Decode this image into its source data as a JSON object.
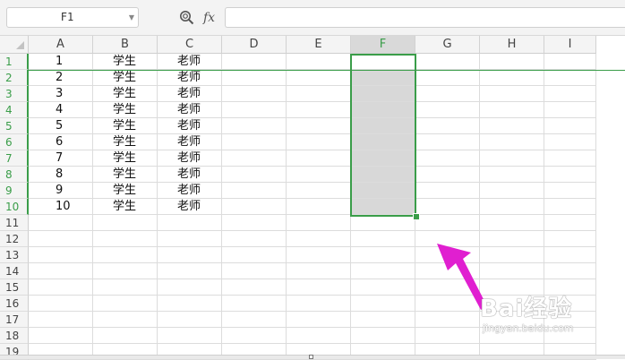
{
  "name_box": {
    "value": "F1"
  },
  "formula_bar": {
    "fx_label": "fx",
    "content": ""
  },
  "columns": [
    "A",
    "B",
    "C",
    "D",
    "E",
    "F",
    "G",
    "H",
    "I"
  ],
  "rows": [
    "1",
    "2",
    "3",
    "4",
    "5",
    "6",
    "7",
    "8",
    "9",
    "10",
    "11",
    "12",
    "13",
    "14",
    "15",
    "16",
    "17",
    "18",
    "19"
  ],
  "cells": [
    [
      "1",
      "学生",
      "老师"
    ],
    [
      "2",
      "学生",
      "老师"
    ],
    [
      "3",
      "学生",
      "老师"
    ],
    [
      "4",
      "学生",
      "老师"
    ],
    [
      "5",
      "学生",
      "老师"
    ],
    [
      "6",
      "学生",
      "老师"
    ],
    [
      "7",
      "学生",
      "老师"
    ],
    [
      "8",
      "学生",
      "老师"
    ],
    [
      "9",
      "学生",
      "老师"
    ],
    [
      "10",
      "学生",
      "老师"
    ]
  ],
  "selection": {
    "active_column": "F",
    "range": "F1:F10"
  },
  "watermark": {
    "brand": "Bai经验",
    "url": "jingyan.baidu.com"
  },
  "colors": {
    "selection": "#3a9d49",
    "arrow": "#e01fd0",
    "selected_fill": "#d8d8d8"
  },
  "icons": {
    "zoom": "zoom-formula-icon",
    "annotation": "pointer-arrow-icon"
  }
}
